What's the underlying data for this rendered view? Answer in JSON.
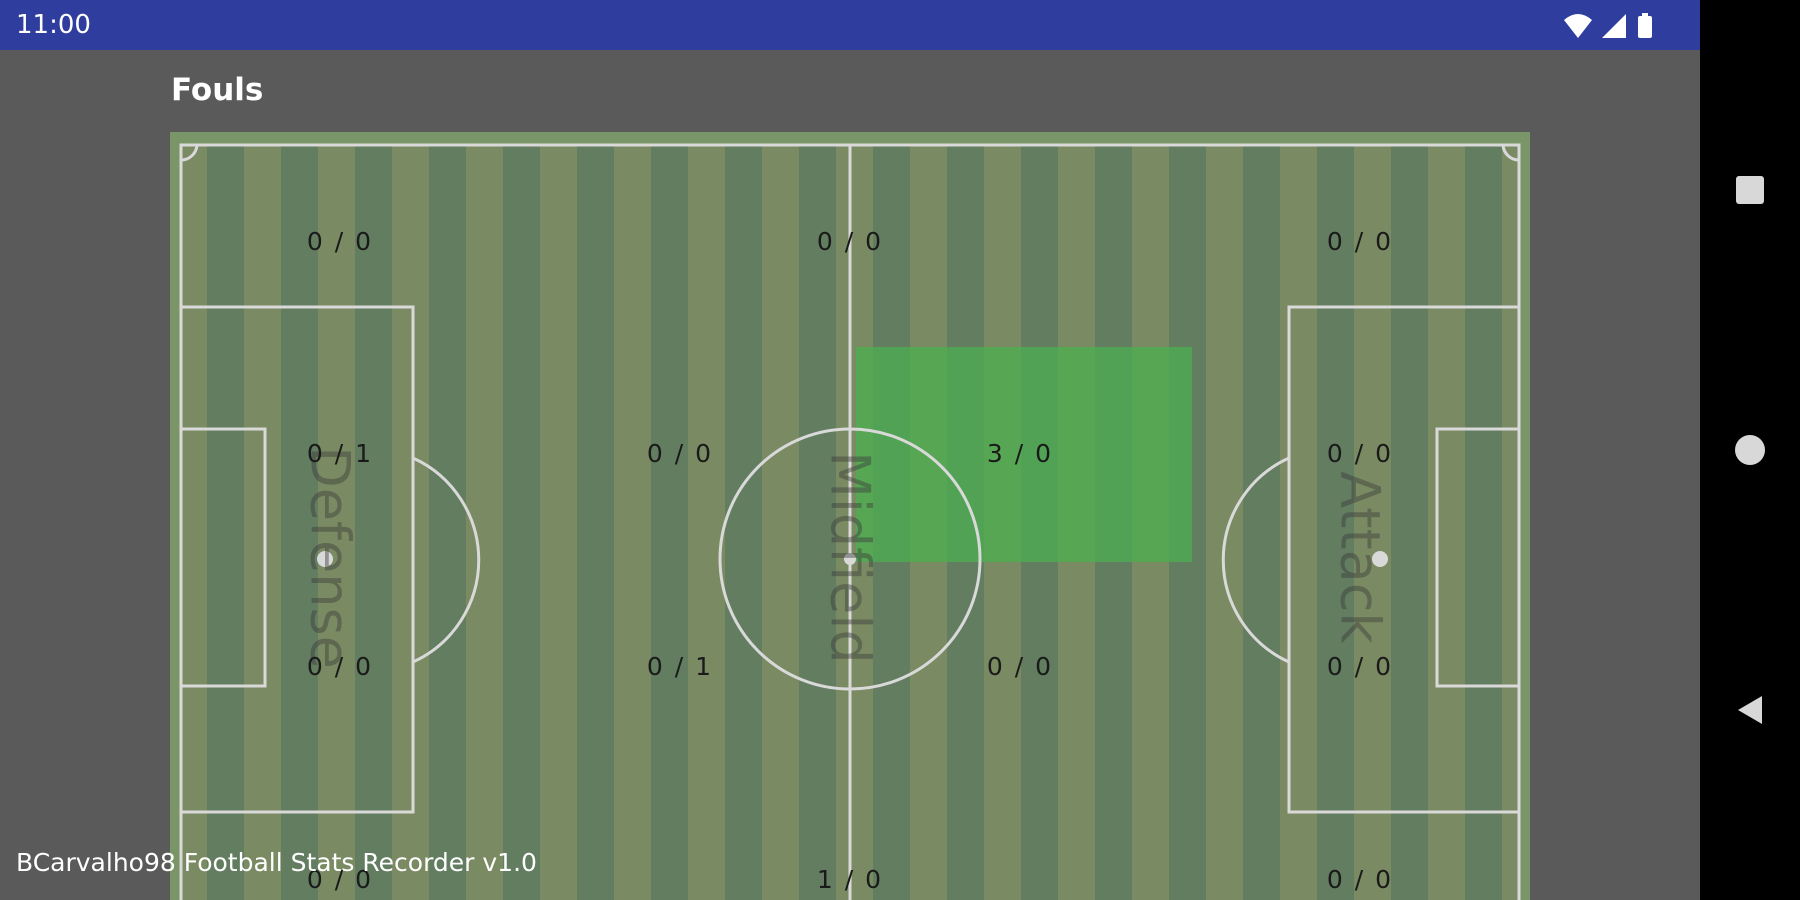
{
  "status_bar": {
    "time": "11:00",
    "icons": [
      "wifi-icon",
      "signal-icon",
      "battery-icon"
    ],
    "background": "#2f3d9e"
  },
  "title": "Fouls",
  "zones": [
    "Defense",
    "Midfield",
    "Attack"
  ],
  "grid": {
    "rows": [
      [
        "0 / 0",
        "0 / 0",
        "0 / 0"
      ],
      [
        "0 / 1",
        "0 / 0",
        "3 / 0",
        "0 / 0"
      ],
      [
        "0 / 0",
        "0 / 1",
        "0 / 0",
        "0 / 0"
      ],
      [
        "0 / 0",
        "1 / 0",
        "0 / 0"
      ]
    ]
  },
  "highlight_color": "#4caf50",
  "footer": "BCarvalho98 Football Stats Recorder v1.0",
  "nav": [
    "recents-button",
    "home-button",
    "back-button"
  ]
}
